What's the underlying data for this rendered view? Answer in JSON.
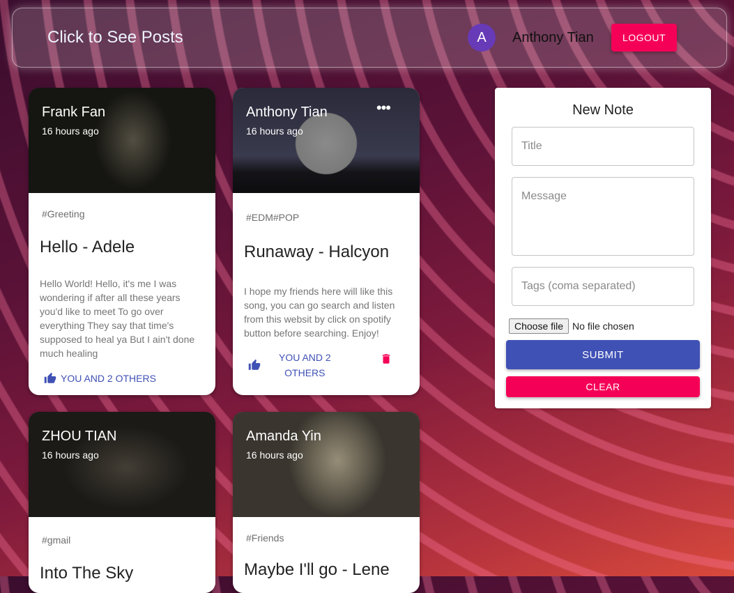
{
  "header": {
    "brand": "Click to See Posts",
    "avatar_letter": "A",
    "username": "Anthony Tian",
    "logout_label": "LOGOUT"
  },
  "posts": [
    {
      "author": "Frank Fan",
      "time": "16 hours ago",
      "tags": "#Greeting",
      "title": "Hello - Adele",
      "message": "Hello World! Hello, it's me I was wondering if after all these years you'd like to meet To go over everything They say that time's supposed to heal ya But I ain't done much healing",
      "likes": "YOU AND 2 OTHERS"
    },
    {
      "author": "Anthony Tian",
      "time": "16 hours ago",
      "tags": "#EDM#POP",
      "title": "Runaway - Halcyon",
      "message": "I hope my friends here will like this song, you can go search and listen from this websit by click on spotify button before searching. Enjoy!",
      "likes_line1": "YOU AND 2",
      "likes_line2": "OTHERS"
    },
    {
      "author": "ZHOU TIAN",
      "time": "16 hours ago",
      "tags": "#gmail",
      "title": "Into The Sky"
    },
    {
      "author": "Amanda Yin",
      "time": "16 hours ago",
      "tags": "#Friends",
      "title": "Maybe I'll go - Lene"
    }
  ],
  "form": {
    "title": "New Note",
    "title_placeholder": "Title",
    "message_placeholder": "Message",
    "tags_placeholder": "Tags (coma separated)",
    "choose_file": "Choose file",
    "no_file": "No file chosen",
    "submit_label": "SUBMIT",
    "clear_label": "CLEAR"
  },
  "colors": {
    "primary": "#3f51b5",
    "secondary": "#f50057",
    "avatar": "#673ab7"
  },
  "icons": [
    "thumb-up-icon",
    "more-horiz-icon",
    "delete-icon"
  ]
}
